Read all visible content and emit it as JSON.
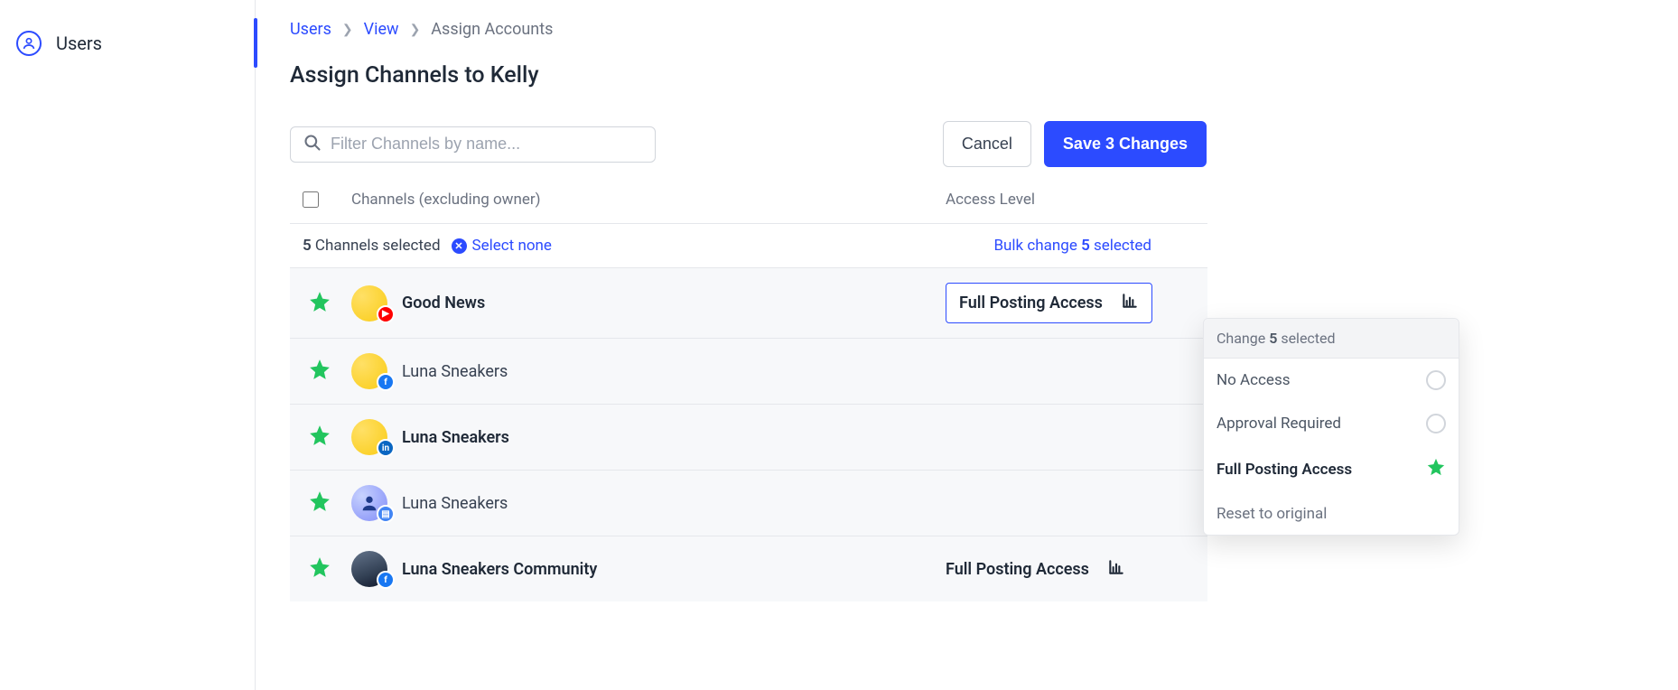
{
  "sidebar": {
    "users_label": "Users"
  },
  "breadcrumb": {
    "users": "Users",
    "view": "View",
    "current": "Assign Accounts"
  },
  "page_title": "Assign Channels to Kelly",
  "search": {
    "placeholder": "Filter Channels by name..."
  },
  "actions": {
    "cancel": "Cancel",
    "save": "Save 3 Changes"
  },
  "table": {
    "header_channels": "Channels (excluding owner)",
    "header_access": "Access Level"
  },
  "selection": {
    "count_num": "5",
    "count_text": " Channels selected",
    "select_none": "Select none",
    "bulk_prefix": "Bulk change ",
    "bulk_num": "5",
    "bulk_suffix": " selected"
  },
  "rows": [
    {
      "name": "Good News",
      "bold": true,
      "platform": "youtube",
      "avatar": "yellow",
      "access_label": "Full Posting Access",
      "trigger": true,
      "show_label": true
    },
    {
      "name": "Luna Sneakers",
      "bold": false,
      "platform": "facebook",
      "avatar": "yellow",
      "access_label": "",
      "trigger": false,
      "show_label": false
    },
    {
      "name": "Luna Sneakers",
      "bold": true,
      "platform": "linkedin",
      "avatar": "yellow",
      "access_label": "",
      "trigger": false,
      "show_label": false
    },
    {
      "name": "Luna Sneakers",
      "bold": false,
      "platform": "google",
      "avatar": "blue",
      "access_label": "",
      "trigger": false,
      "show_label": false
    },
    {
      "name": "Luna Sneakers Community",
      "bold": true,
      "platform": "facebook",
      "avatar": "photo",
      "access_label": "Full Posting Access",
      "trigger": false,
      "show_label": true
    }
  ],
  "dropdown": {
    "header_prefix": "Change ",
    "header_num": "5",
    "header_suffix": " selected",
    "options": {
      "no_access": "No Access",
      "approval": "Approval Required",
      "full": "Full Posting Access",
      "reset": "Reset to original"
    }
  }
}
